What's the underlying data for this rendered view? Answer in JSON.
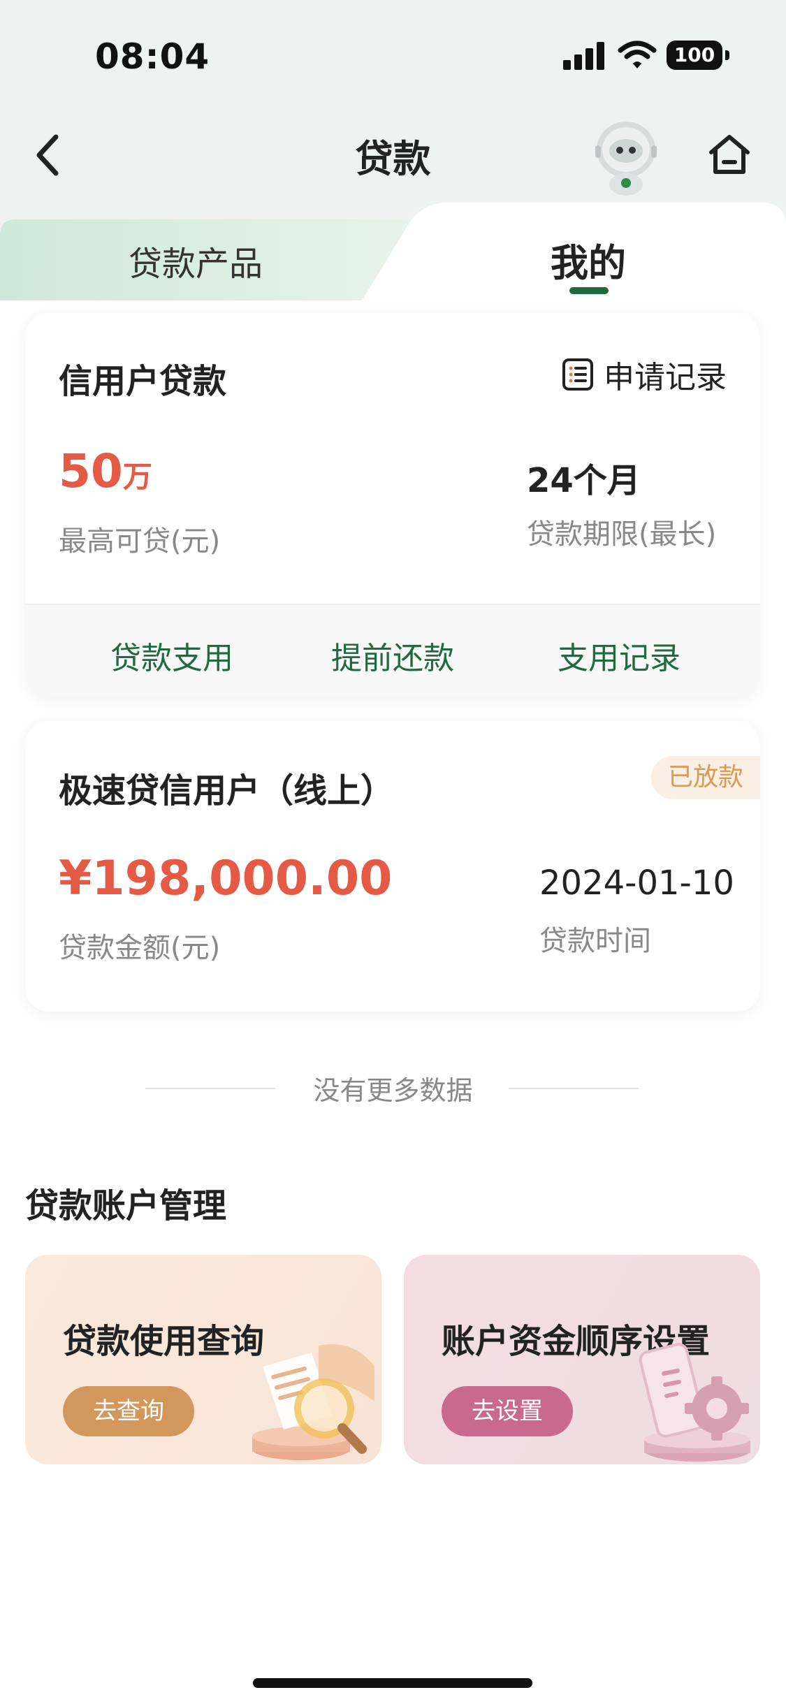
{
  "status_bar": {
    "time": "08:04",
    "battery": "100"
  },
  "nav": {
    "title": "贷款"
  },
  "tabs": [
    {
      "label": "贷款产品",
      "active": false
    },
    {
      "label": "我的",
      "active": true
    }
  ],
  "colors": {
    "brand_green": "#1f6b3f",
    "amount_red": "#e55a45",
    "badge_text": "#d69b57"
  },
  "credit_loan_card": {
    "title": "信用户贷款",
    "apply_record_label": "申请记录",
    "max_amount_number": "50",
    "max_amount_unit": "万",
    "max_amount_label": "最高可贷(元)",
    "term_value": "24个月",
    "term_label": "贷款期限(最长)",
    "actions": [
      "贷款支用",
      "提前还款",
      "支用记录"
    ]
  },
  "fast_loan_card": {
    "title": "极速贷信用户（线上）",
    "status_badge": "已放款",
    "amount": "¥198,000.00",
    "amount_label": "贷款金额(元)",
    "date": "2024-01-10",
    "date_label": "贷款时间"
  },
  "no_more_text": "没有更多数据",
  "account_management": {
    "title": "贷款账户管理",
    "cards": [
      {
        "title": "贷款使用查询",
        "button": "去查询",
        "icon": "document-search-icon"
      },
      {
        "title": "账户资金顺序设置",
        "button": "去设置",
        "icon": "phone-gear-icon"
      }
    ]
  }
}
